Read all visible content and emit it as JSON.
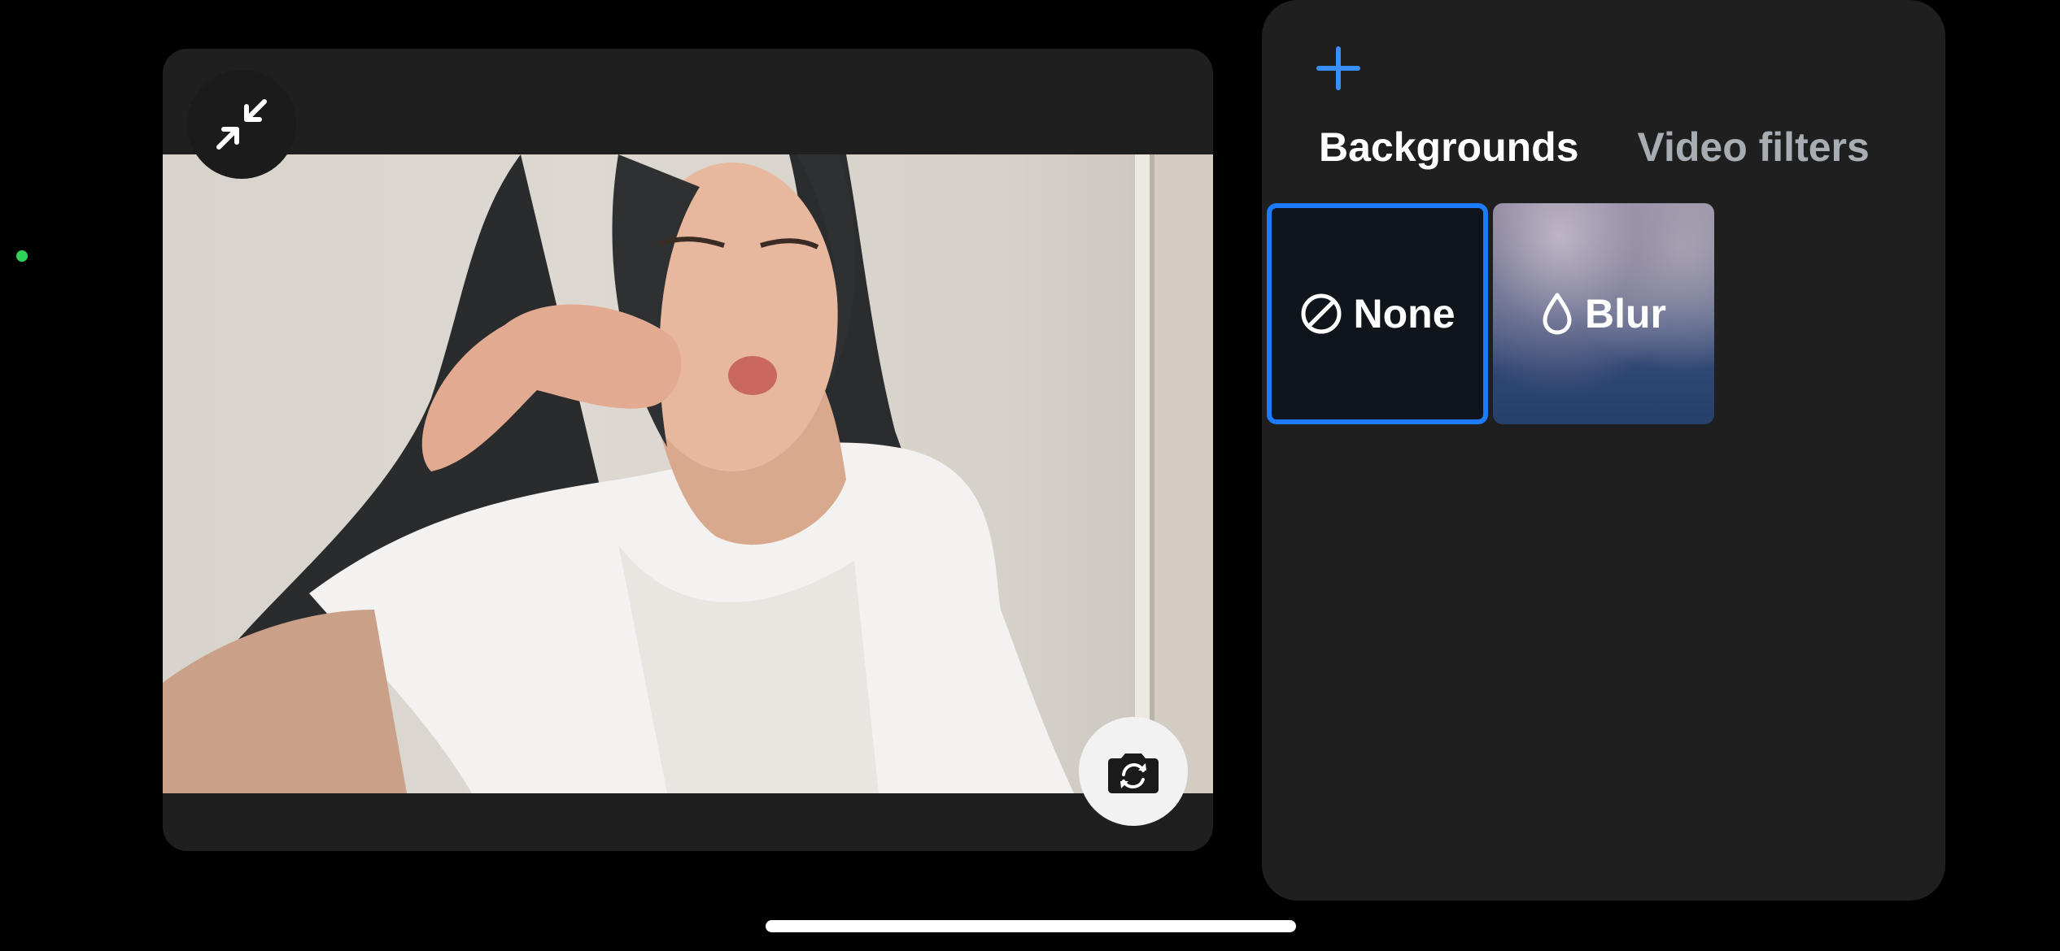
{
  "preview": {
    "minimize_button": {
      "icon": "minimize-arrows-icon"
    },
    "flip_camera_button": {
      "icon": "camera-flip-icon"
    }
  },
  "effects_panel": {
    "add_button": {
      "icon": "plus-icon",
      "color": "#3a8fff"
    },
    "tabs": [
      {
        "label": "Backgrounds",
        "active": true
      },
      {
        "label": "Video filters",
        "active": false
      }
    ],
    "options": [
      {
        "label": "None",
        "icon": "none-slash-icon",
        "selected": true
      },
      {
        "label": "Blur",
        "icon": "droplet-icon",
        "selected": false
      }
    ],
    "accent_color": "#1d7bff"
  },
  "status": {
    "camera_indicator_color": "#30d158"
  }
}
